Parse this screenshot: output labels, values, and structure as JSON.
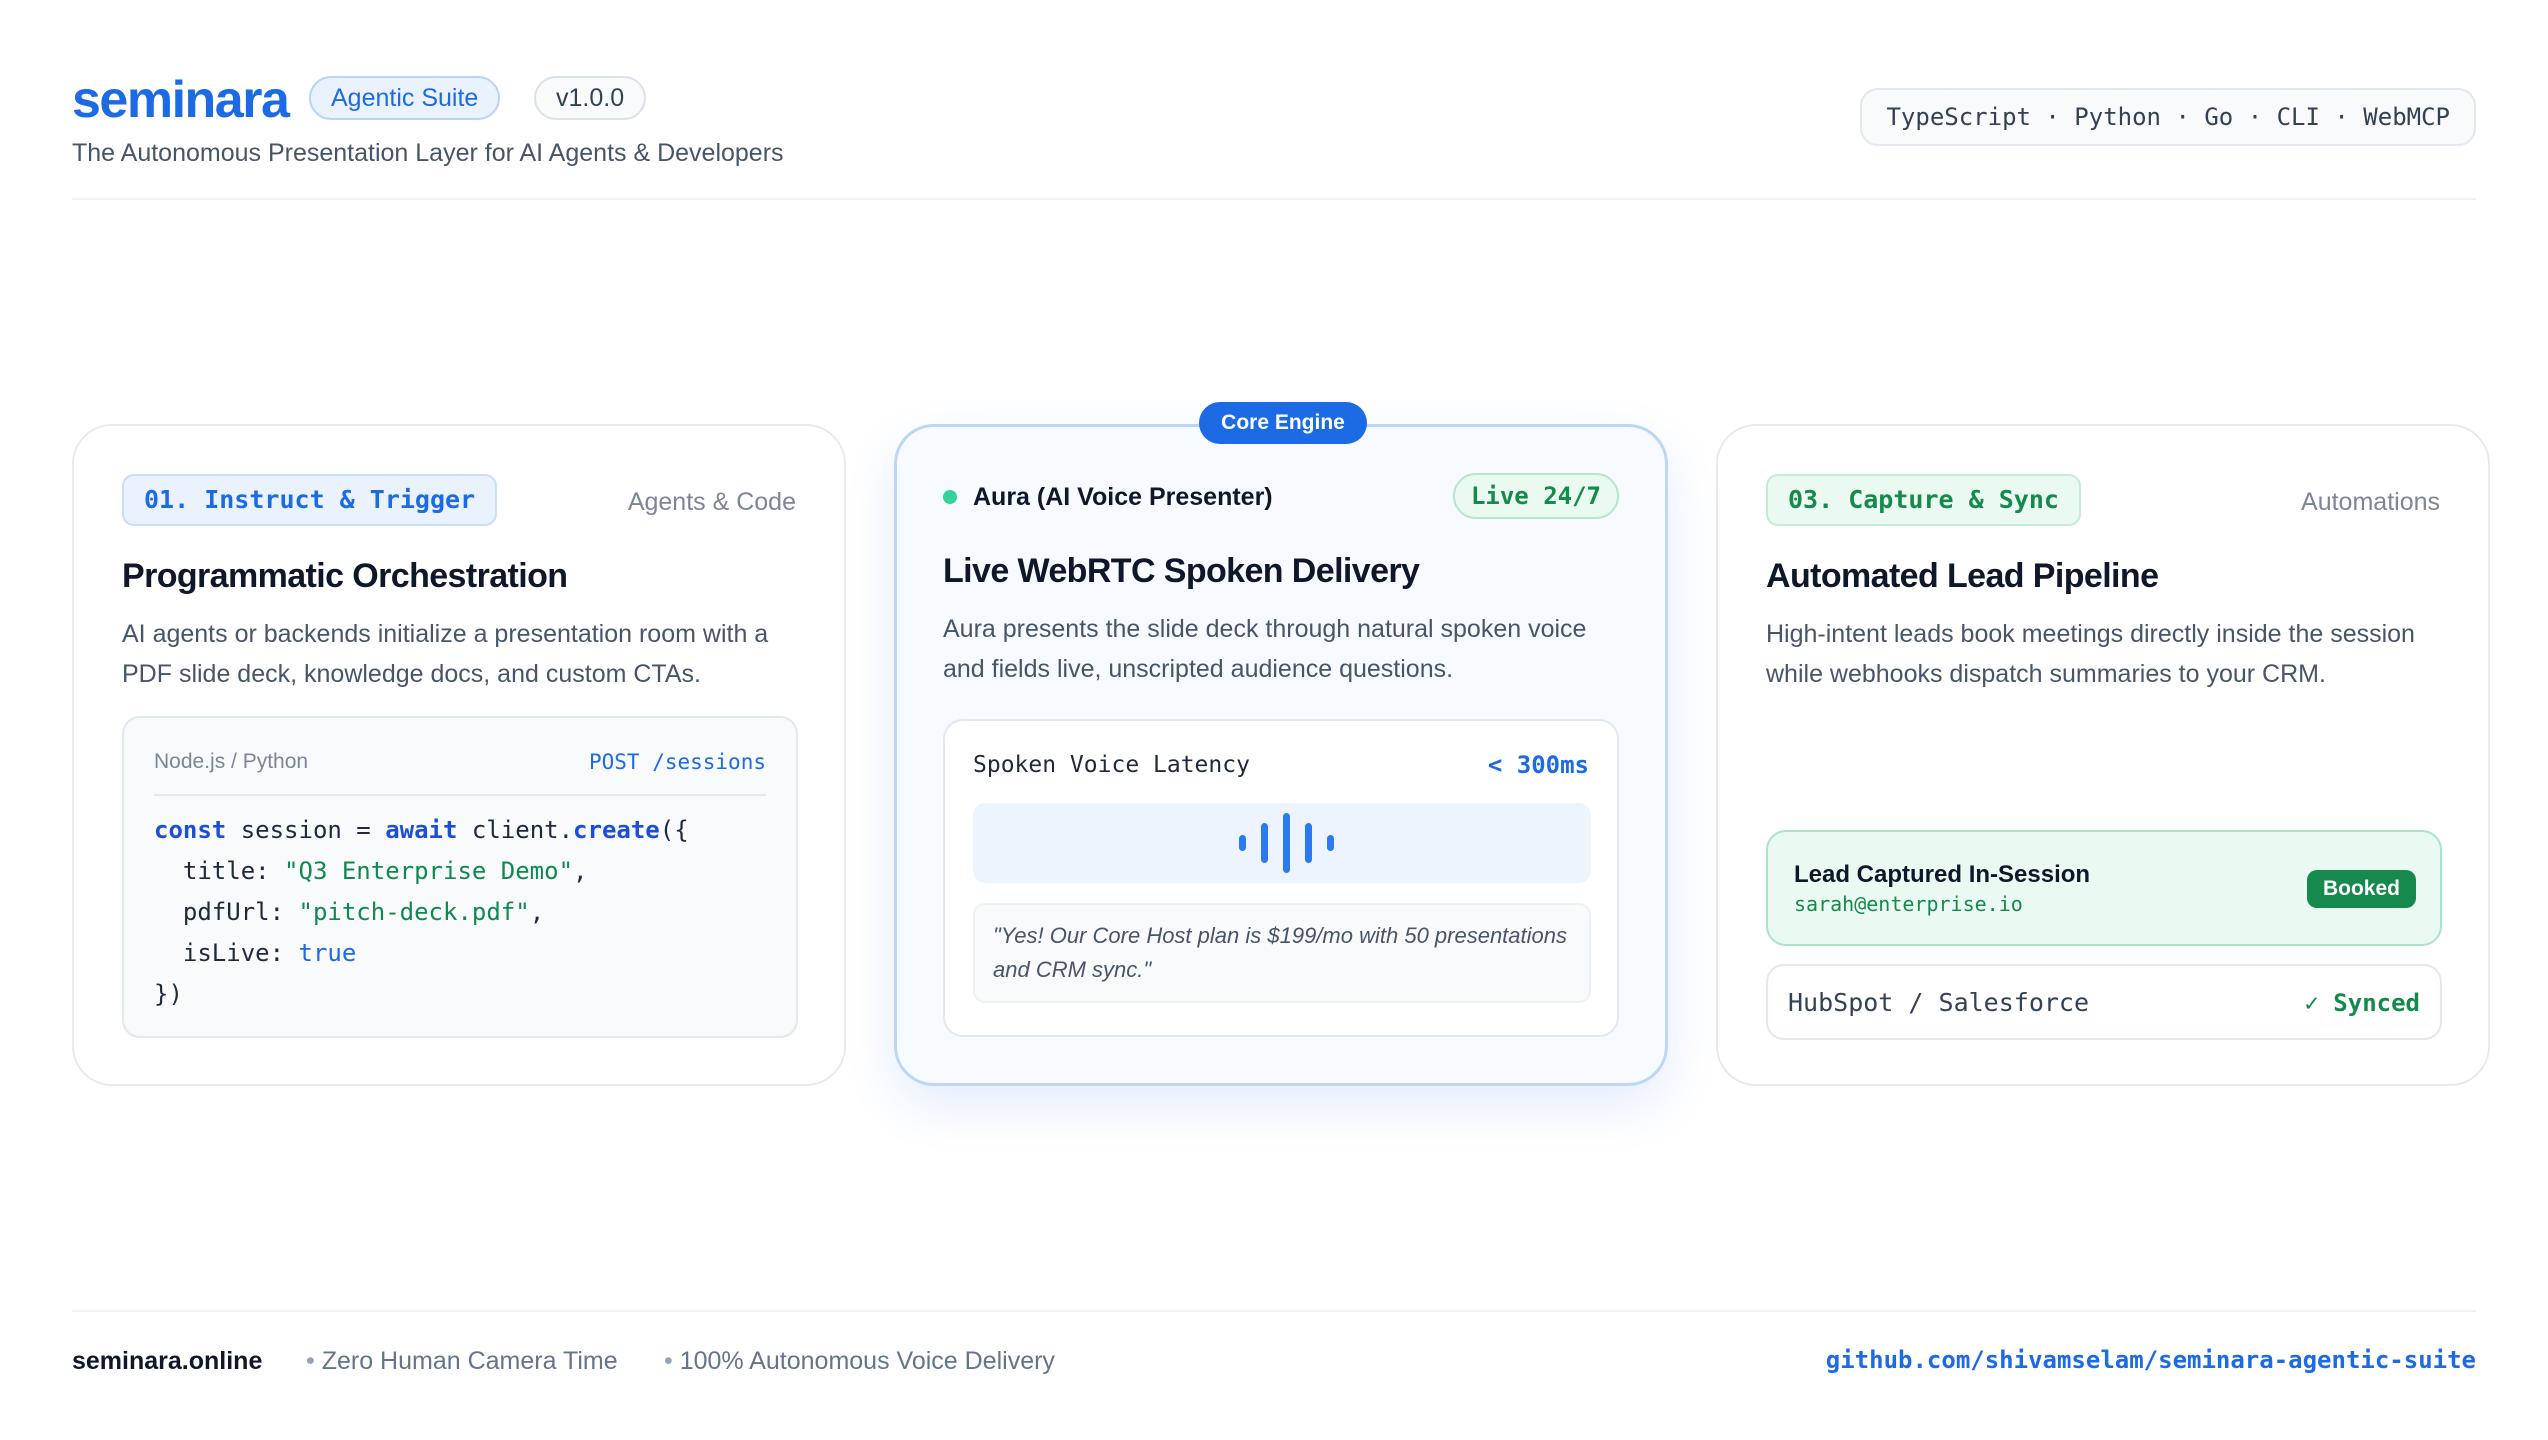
{
  "header": {
    "logo": "seminara",
    "suite_badge": "Agentic Suite",
    "version_badge": "v1.0.0",
    "subtitle": "The Autonomous Presentation Layer for AI Agents & Developers",
    "languages": "TypeScript · Python · Go · CLI · WebMCP"
  },
  "cards": {
    "instruct": {
      "tag": "01. Instruct & Trigger",
      "category": "Agents & Code",
      "title": "Programmatic Orchestration",
      "description": "AI agents or backends initialize a presentation room with a PDF slide deck, knowledge docs, and custom CTAs.",
      "code": {
        "lang_label": "Node.js / Python",
        "endpoint": "POST /sessions",
        "line1_kw": "const",
        "line1_var": " session = ",
        "line1_await": "await",
        "line1_obj": " client.",
        "line1_fn": "create",
        "line1_end": "({",
        "title_key": "  title: ",
        "title_val": "\"Q3 Enterprise Demo\"",
        "pdf_key": "  pdfUrl: ",
        "pdf_val": "\"pitch-deck.pdf\"",
        "live_key": "  isLive: ",
        "live_val": "true",
        "close": "})",
        "comma": ","
      }
    },
    "core": {
      "badge": "Core Engine",
      "presenter": "Aura (AI Voice Presenter)",
      "status": "Live 24/7",
      "title": "Live WebRTC Spoken Delivery",
      "description": "Aura presents the slide deck through natural spoken voice and fields live, unscripted audience questions.",
      "latency_label": "Spoken Voice Latency",
      "latency_value": "< 300ms",
      "quote": "\"Yes! Our Core Host plan is $199/mo with 50 presentations and CRM sync.\""
    },
    "capture": {
      "tag": "03. Capture & Sync",
      "category": "Automations",
      "title": "Automated Lead Pipeline",
      "description": "High-intent leads book meetings directly inside the session while webhooks dispatch summaries to your CRM.",
      "lead_title": "Lead Captured In-Session",
      "lead_email": "sarah@enterprise.io",
      "lead_status": "Booked",
      "crm_label": "HubSpot / Salesforce",
      "crm_status": "✓ Synced"
    }
  },
  "footer": {
    "site": "seminara.online",
    "item1": "Zero Human Camera Time",
    "item2": "100% Autonomous Voice Delivery",
    "github": "github.com/shivamselam/seminara-agentic-suite"
  },
  "colors": {
    "brand_blue": "#1d6ae5",
    "success_green": "#158a4c",
    "live_dot": "#34d399"
  }
}
